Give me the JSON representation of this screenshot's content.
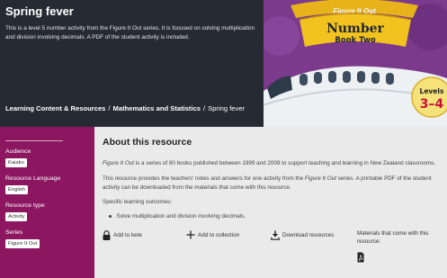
{
  "hero": {
    "title": "Spring fever",
    "description": "This is a level 5 number activity from the Figure It Out series. It is focused on solving multiplication and division involving decimals. A PDF of the student activity is included."
  },
  "breadcrumb": {
    "items": [
      "Learning Content & Resources",
      "Mathematics and Statistics"
    ],
    "separator": "/",
    "current": "Spring fever"
  },
  "cover": {
    "series_logo": "Figure It Out",
    "subject": "Number",
    "book": "Book Two",
    "levels_label": "Levels",
    "levels": "3–4"
  },
  "sidebar": {
    "audience_label": "Audience",
    "audience_value": "Kaiako",
    "language_label": "Resource Language",
    "language_value": "English",
    "type_label": "Resource type",
    "type_value": "Activity",
    "series_label": "Series",
    "series_value": "Figure It Out"
  },
  "about": {
    "title": "About this resource",
    "para1_series": "Figure It Out",
    "para1_rest": " is a series of 80 books published between 1999 and 2009 to support teaching and learning in New Zealand classrooms.",
    "para2_start": "This resource provides the teachers' notes and answers for one activity from the ",
    "para2_series": "Figure It Out",
    "para2_end": " series. A printable PDF of the student activity can be downloaded from the materials that come with this resource.",
    "outcomes_label": "Specific learning outcomes:",
    "outcome_1": "Solve multiplication and division involving decimals."
  },
  "actions": {
    "add_to_kete": "Add to kete",
    "add_to_collection": "Add to collection",
    "download": "Download resources"
  },
  "materials": {
    "label": "Materials that come with this resource:",
    "icon": "pdf-file-icon"
  },
  "colors": {
    "hero_bg": "#262b33",
    "sidebar_bg": "#8c1660",
    "main_bg": "#eaeaea",
    "cover_bg": "#7b3a8c",
    "cover_banner": "#f2c21f"
  }
}
